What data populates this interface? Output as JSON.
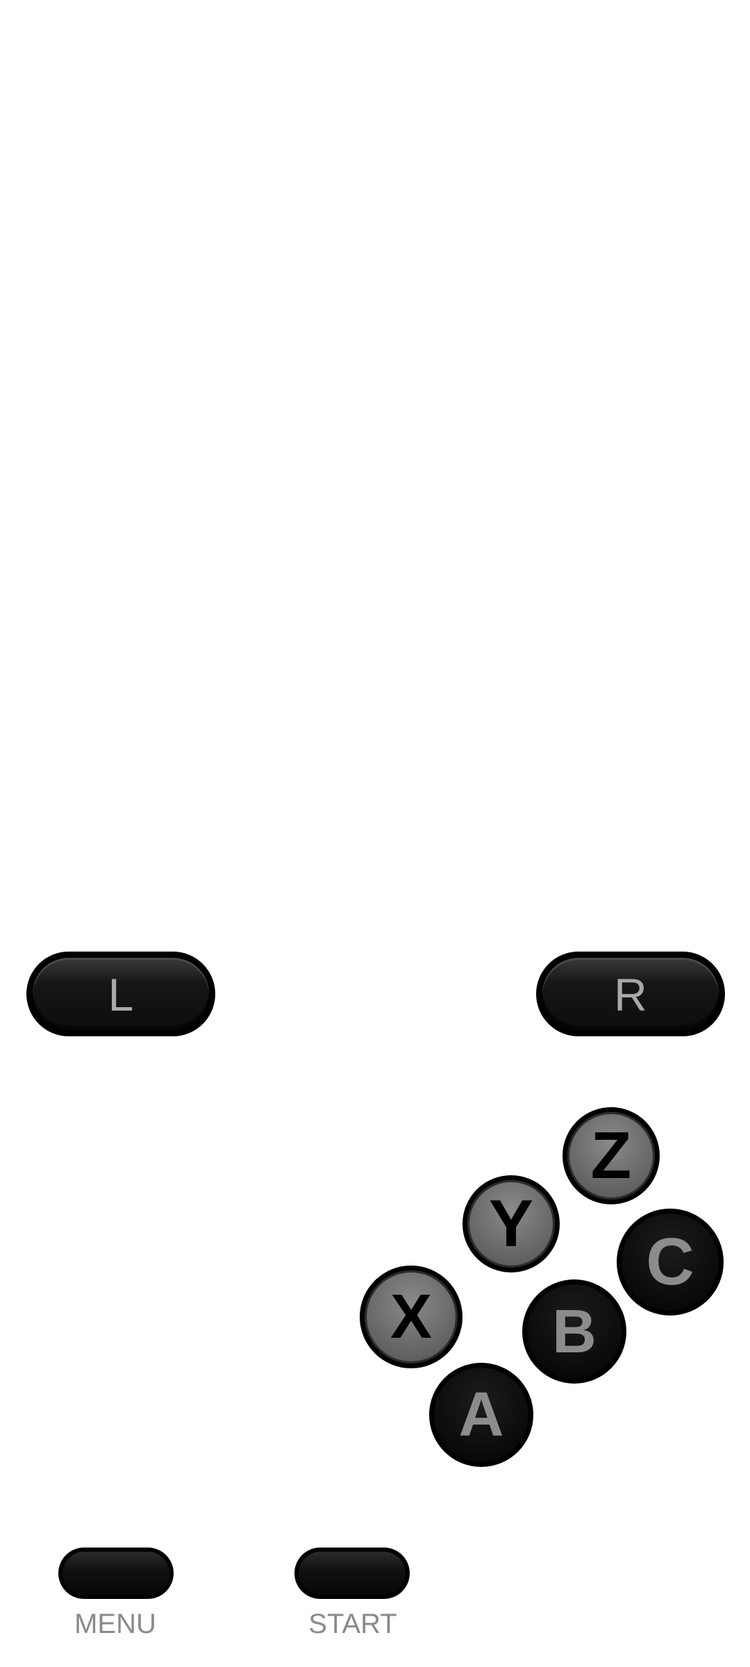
{
  "shoulder_buttons": {
    "left": "L",
    "right": "R"
  },
  "face_buttons": {
    "z": "Z",
    "y": "Y",
    "c": "C",
    "x": "X",
    "b": "B",
    "a": "A"
  },
  "system_buttons": {
    "menu": "MENU",
    "start": "START"
  },
  "colors": {
    "background": "#ffffff",
    "button_dark": "#0a0a0a",
    "button_light": "#6a6a6a",
    "label_gray": "#8a8a8a"
  }
}
